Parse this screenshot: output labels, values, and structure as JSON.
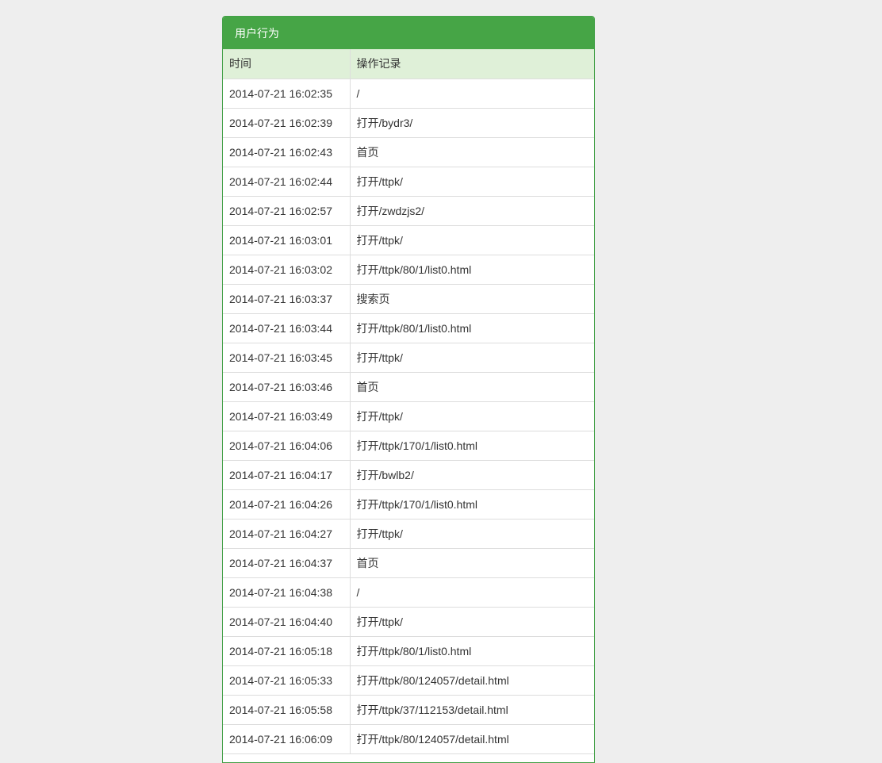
{
  "panel": {
    "title": "用户行为"
  },
  "table": {
    "headers": [
      "时间",
      "操作记录"
    ],
    "rows": [
      {
        "time": "2014-07-21 16:02:35",
        "action": "/"
      },
      {
        "time": "2014-07-21 16:02:39",
        "action": "打开/bydr3/"
      },
      {
        "time": "2014-07-21 16:02:43",
        "action": "首页"
      },
      {
        "time": "2014-07-21 16:02:44",
        "action": "打开/ttpk/"
      },
      {
        "time": "2014-07-21 16:02:57",
        "action": "打开/zwdzjs2/"
      },
      {
        "time": "2014-07-21 16:03:01",
        "action": "打开/ttpk/"
      },
      {
        "time": "2014-07-21 16:03:02",
        "action": "打开/ttpk/80/1/list0.html"
      },
      {
        "time": "2014-07-21 16:03:37",
        "action": "搜索页"
      },
      {
        "time": "2014-07-21 16:03:44",
        "action": "打开/ttpk/80/1/list0.html"
      },
      {
        "time": "2014-07-21 16:03:45",
        "action": "打开/ttpk/"
      },
      {
        "time": "2014-07-21 16:03:46",
        "action": "首页"
      },
      {
        "time": "2014-07-21 16:03:49",
        "action": "打开/ttpk/"
      },
      {
        "time": "2014-07-21 16:04:06",
        "action": "打开/ttpk/170/1/list0.html"
      },
      {
        "time": "2014-07-21 16:04:17",
        "action": "打开/bwlb2/"
      },
      {
        "time": "2014-07-21 16:04:26",
        "action": "打开/ttpk/170/1/list0.html"
      },
      {
        "time": "2014-07-21 16:04:27",
        "action": "打开/ttpk/"
      },
      {
        "time": "2014-07-21 16:04:37",
        "action": "首页"
      },
      {
        "time": "2014-07-21 16:04:38",
        "action": "/"
      },
      {
        "time": "2014-07-21 16:04:40",
        "action": "打开/ttpk/"
      },
      {
        "time": "2014-07-21 16:05:18",
        "action": "打开/ttpk/80/1/list0.html"
      },
      {
        "time": "2014-07-21 16:05:33",
        "action": "打开/ttpk/80/124057/detail.html"
      },
      {
        "time": "2014-07-21 16:05:58",
        "action": "打开/ttpk/37/112153/detail.html"
      },
      {
        "time": "2014-07-21 16:06:09",
        "action": "打开/ttpk/80/124057/detail.html"
      }
    ]
  },
  "colors": {
    "panel_header": "#46a546",
    "table_header": "#dff0d8",
    "page_background": "#eeeeee"
  }
}
